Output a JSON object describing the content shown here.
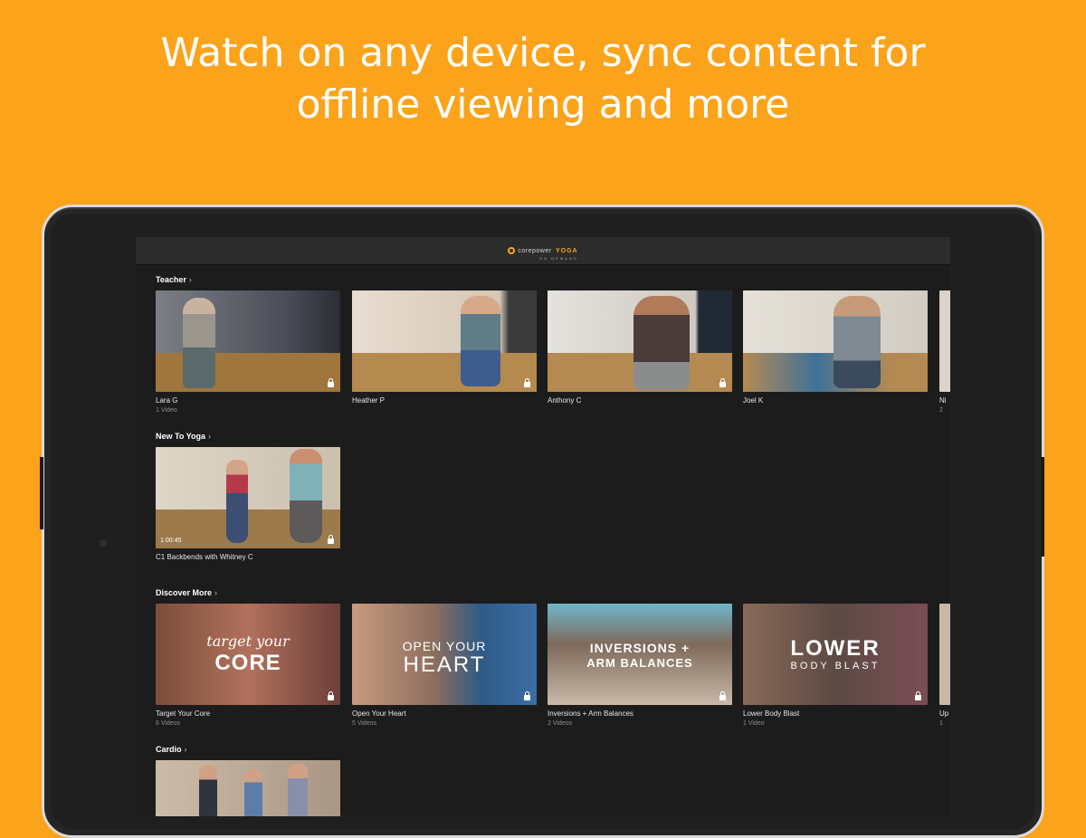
{
  "headline": {
    "line1": "Watch on any device, sync content for",
    "line2": "offline viewing and more"
  },
  "app": {
    "logo_text": "corepower",
    "logo_accent": "YOGA",
    "logo_sub": "ON DEMAND"
  },
  "sections": [
    {
      "title": "Teacher",
      "cards": [
        {
          "title": "Lara G",
          "subtitle": "1 Video"
        },
        {
          "title": "Heather P",
          "subtitle": ""
        },
        {
          "title": "Anthony C",
          "subtitle": ""
        },
        {
          "title": "Joel K",
          "subtitle": ""
        },
        {
          "title": "Ni",
          "subtitle": "2"
        }
      ]
    },
    {
      "title": "New To Yoga",
      "cards": [
        {
          "title": "C1 Backbends with Whitney C",
          "subtitle": "",
          "duration": "1:00:45"
        }
      ]
    },
    {
      "title": "Discover More",
      "cards": [
        {
          "title": "Target Your Core",
          "subtitle": "6 Videos",
          "overlay_line1": "target your",
          "overlay_line2": "CORE"
        },
        {
          "title": "Open Your Heart",
          "subtitle": "5 Videos",
          "overlay_line1": "OPEN YOUR",
          "overlay_line2": "HEART"
        },
        {
          "title": "Inversions + Arm Balances",
          "subtitle": "2 Videos",
          "overlay_line1": "INVERSIONS +",
          "overlay_line2": "ARM BALANCES"
        },
        {
          "title": "Lower Body Blast",
          "subtitle": "1 Video",
          "overlay_line1": "LOWER",
          "overlay_line2": "BODY BLAST"
        },
        {
          "title": "Up",
          "subtitle": "1"
        }
      ]
    },
    {
      "title": "Cardio",
      "cards": []
    }
  ],
  "colors": {
    "background": "#FBA31B",
    "accent": "#FBA31B"
  },
  "icons": {
    "chevron": "chevron-right-icon",
    "lock": "lock-icon"
  }
}
